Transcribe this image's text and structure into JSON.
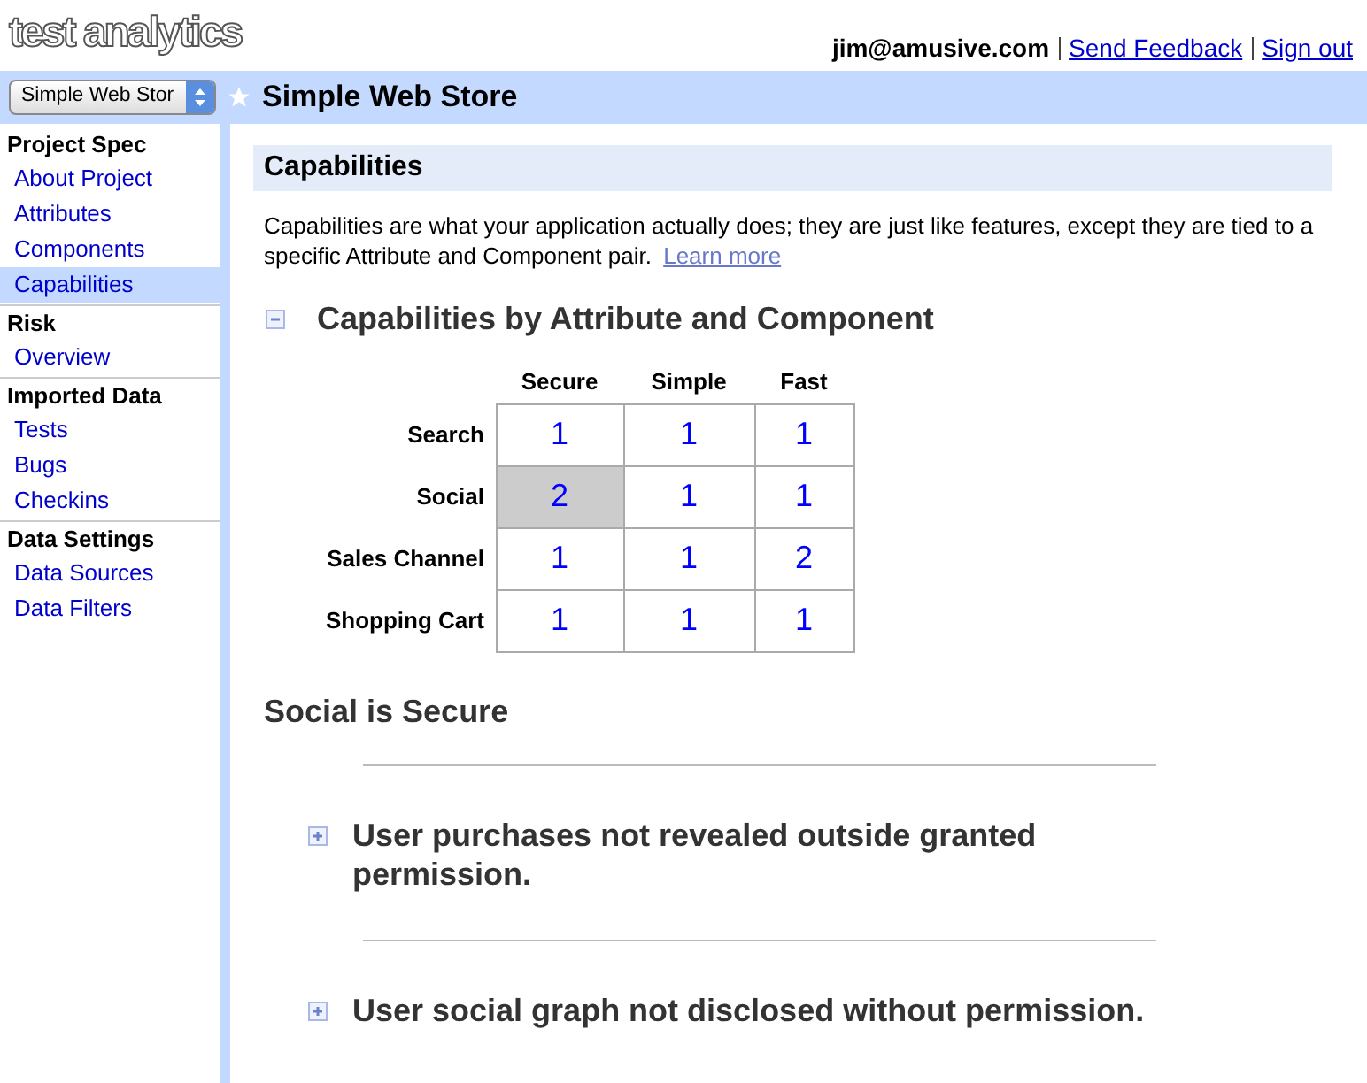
{
  "header": {
    "logo": "test analytics",
    "user": "jim@amusive.com",
    "links": [
      "Send Feedback",
      "Sign out"
    ]
  },
  "project_bar": {
    "selector": "Simple Web Stor",
    "title": "Simple Web Store",
    "starred": true
  },
  "sidebar": {
    "sections": [
      {
        "title": "Project Spec",
        "items": [
          {
            "label": "About Project",
            "selected": false
          },
          {
            "label": "Attributes",
            "selected": false
          },
          {
            "label": "Components",
            "selected": false
          },
          {
            "label": "Capabilities",
            "selected": true
          }
        ]
      },
      {
        "title": "Risk",
        "items": [
          {
            "label": "Overview",
            "selected": false
          }
        ]
      },
      {
        "title": "Imported Data",
        "items": [
          {
            "label": "Tests",
            "selected": false
          },
          {
            "label": "Bugs",
            "selected": false
          },
          {
            "label": "Checkins",
            "selected": false
          }
        ]
      },
      {
        "title": "Data Settings",
        "items": [
          {
            "label": "Data Sources",
            "selected": false
          },
          {
            "label": "Data Filters",
            "selected": false
          }
        ]
      }
    ]
  },
  "page": {
    "title": "Capabilities",
    "description": "Capabilities are what your application actually does; they are just like features, except they are tied to a specific Attribute and Component pair.",
    "learn_more": "Learn more"
  },
  "matrix": {
    "title": "Capabilities by Attribute and Component",
    "expanded": true,
    "columns": [
      "Secure",
      "Simple",
      "Fast"
    ],
    "rows": [
      {
        "label": "Search",
        "cells": [
          {
            "value": "1",
            "selected": false
          },
          {
            "value": "1",
            "selected": false
          },
          {
            "value": "1",
            "selected": false
          }
        ]
      },
      {
        "label": "Social",
        "cells": [
          {
            "value": "2",
            "selected": true
          },
          {
            "value": "1",
            "selected": false
          },
          {
            "value": "1",
            "selected": false
          }
        ]
      },
      {
        "label": "Sales Channel",
        "cells": [
          {
            "value": "1",
            "selected": false
          },
          {
            "value": "1",
            "selected": false
          },
          {
            "value": "2",
            "selected": false
          }
        ]
      },
      {
        "label": "Shopping Cart",
        "cells": [
          {
            "value": "1",
            "selected": false
          },
          {
            "value": "1",
            "selected": false
          },
          {
            "value": "1",
            "selected": false
          }
        ]
      }
    ]
  },
  "selection": {
    "title": "Social is Secure",
    "capabilities": [
      {
        "text": "User purchases not revealed outside granted permission.",
        "expanded": false
      },
      {
        "text": "User social graph not disclosed without permission.",
        "expanded": false
      }
    ]
  }
}
